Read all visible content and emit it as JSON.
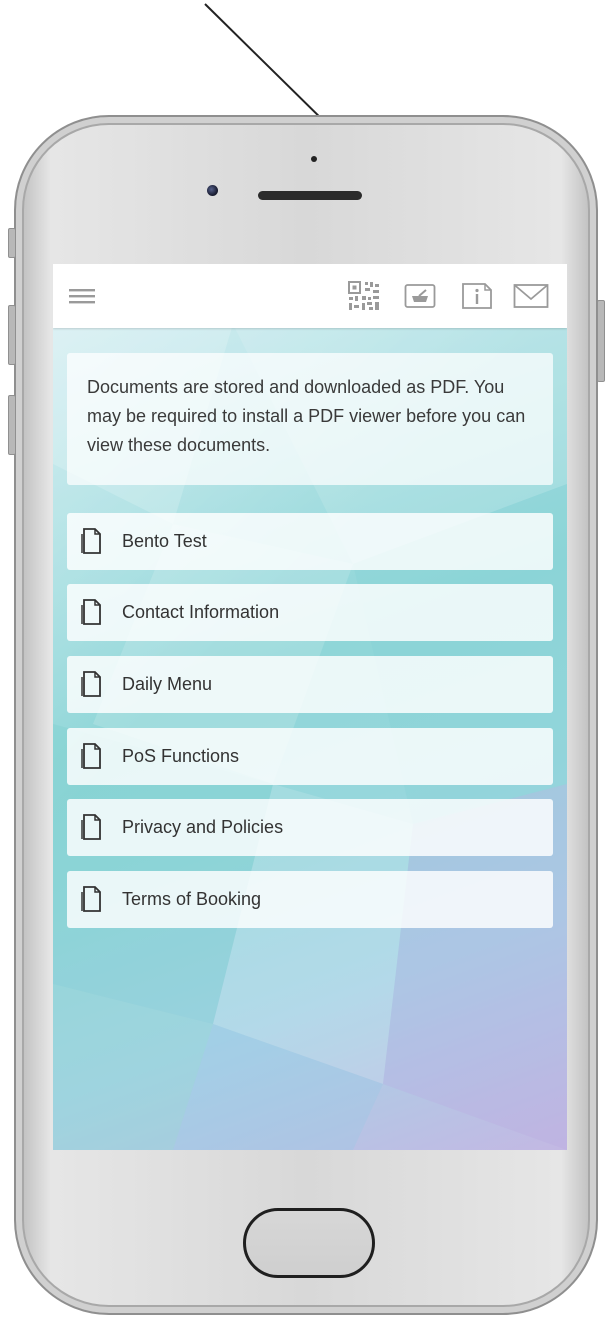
{
  "header": {
    "menu_icon": "hamburger-menu-icon",
    "actions": [
      {
        "icon": "qr-code-icon"
      },
      {
        "icon": "mortar-pestle-icon"
      },
      {
        "icon": "info-icon"
      },
      {
        "icon": "mail-icon"
      }
    ]
  },
  "notice": {
    "text": "Documents are stored and downloaded as PDF. You may be required to install a PDF viewer before you can view these documents."
  },
  "documents": [
    {
      "label": "Bento Test",
      "icon": "document-icon"
    },
    {
      "label": "Contact Information",
      "icon": "document-icon"
    },
    {
      "label": "Daily Menu",
      "icon": "document-icon"
    },
    {
      "label": "PoS Functions",
      "icon": "document-icon"
    },
    {
      "label": "Privacy and Policies",
      "icon": "document-icon"
    },
    {
      "label": "Terms of Booking",
      "icon": "document-icon"
    }
  ],
  "colors": {
    "icon_gray": "#9a9a9a",
    "text": "#333333",
    "background_teal": "#8fd6d8",
    "background_lavender": "#c3b8e3"
  }
}
